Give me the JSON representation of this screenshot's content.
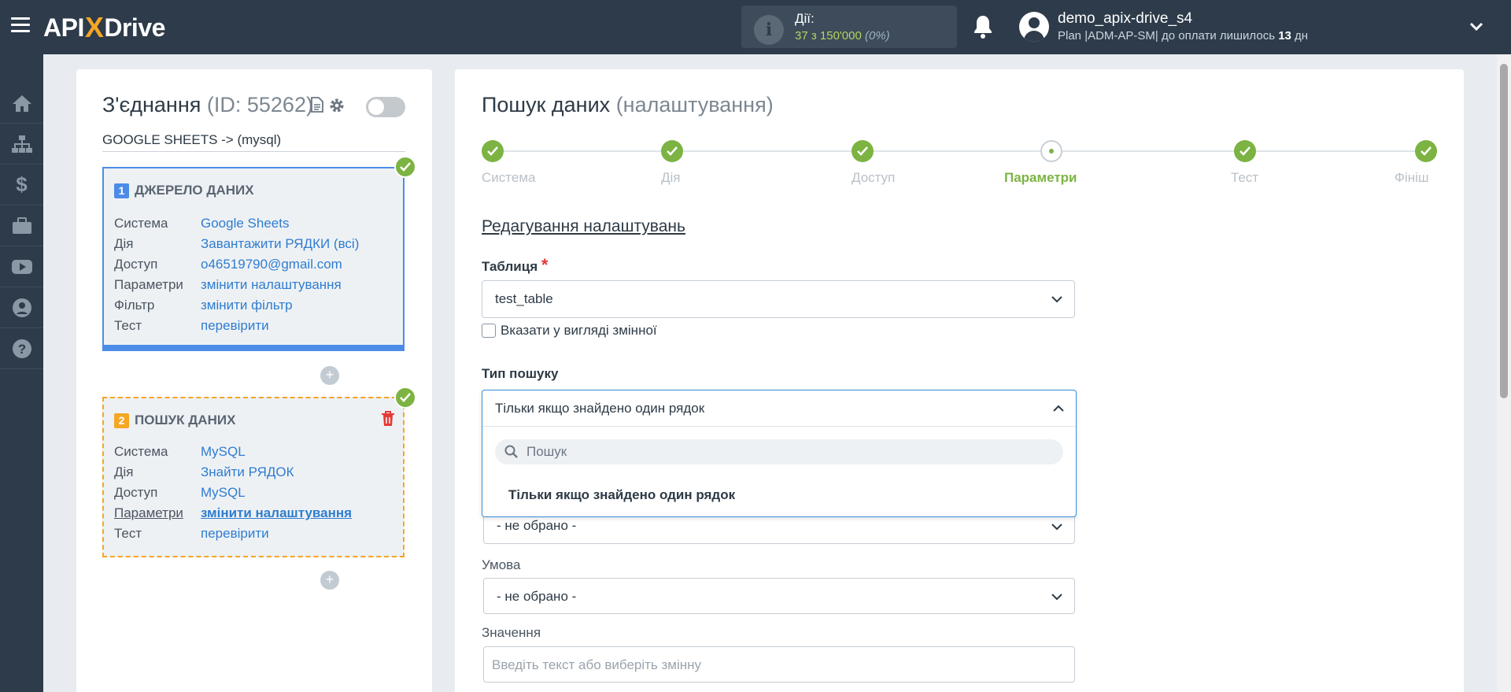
{
  "brand": {
    "pre": "API",
    "x": "X",
    "post": "Drive"
  },
  "actions": {
    "label": "Дії:",
    "count": "37 з 150'000",
    "percent": "(0%)"
  },
  "user": {
    "name": "demo_apix-drive_s4",
    "plan_prefix": "Plan |ADM-AP-SM| до оплати лишилось ",
    "days": "13",
    "days_suffix": " дн"
  },
  "sidebar": {
    "items": [
      "home-icon",
      "sitemap-icon",
      "dollar-icon",
      "briefcase-icon",
      "youtube-icon",
      "user-icon",
      "help-icon"
    ]
  },
  "connection": {
    "title": "З'єднання",
    "id_text": "(ID: 55262)",
    "subtitle": "GOOGLE SHEETS -> (mysql)"
  },
  "cards": [
    {
      "num": "1",
      "title": "ДЖЕРЕЛО ДАНИХ",
      "rows": [
        {
          "key": "Система",
          "value": "Google Sheets"
        },
        {
          "key": "Дія",
          "value": "Завантажити РЯДКИ (всі)"
        },
        {
          "key": "Доступ",
          "value": "o46519790@gmail.com"
        },
        {
          "key": "Параметри",
          "value": "змінити налаштування"
        },
        {
          "key": "Фільтр",
          "value": "змінити фільтр"
        },
        {
          "key": "Тест",
          "value": "перевірити"
        }
      ]
    },
    {
      "num": "2",
      "title": "ПОШУК ДАНИХ",
      "rows": [
        {
          "key": "Система",
          "value": "MySQL"
        },
        {
          "key": "Дія",
          "value": "Знайти РЯДОК"
        },
        {
          "key": "Доступ",
          "value": "MySQL"
        },
        {
          "key": "Параметри",
          "value": "змінити налаштування"
        },
        {
          "key": "Тест",
          "value": "перевірити"
        }
      ]
    }
  ],
  "plus": "+",
  "main": {
    "title": "Пошук даних",
    "title_muted": "(налаштування)",
    "steps": [
      {
        "label": "Система"
      },
      {
        "label": "Дія"
      },
      {
        "label": "Доступ"
      },
      {
        "label": "Параметри"
      },
      {
        "label": "Тест"
      },
      {
        "label": "Фініш"
      }
    ],
    "current_step": "Параметри",
    "section_title": "Редагування налаштувань",
    "table": {
      "label": "Таблиця",
      "required_mark": "*",
      "value": "test_table"
    },
    "variable_checkbox": {
      "label": "Вказати у вигляді змінної",
      "checked": false
    },
    "search_type": {
      "label": "Тип пошуку",
      "value": "Тільки якщо знайдено один рядок",
      "search_placeholder": "Пошук",
      "options": [
        "Тільки якщо знайдено один рядок"
      ]
    },
    "field_select": {
      "value": "- не обрано -"
    },
    "condition": {
      "label": "Умова",
      "value": "- не обрано -"
    },
    "value_field": {
      "label": "Значення",
      "placeholder": "Введіть текст або виберіть змінну"
    }
  },
  "colors": {
    "topbar": "#2d3b4a",
    "accent_green": "#7cb342",
    "accent_blue": "#4c8ce8",
    "accent_orange": "#f5a623",
    "link": "#2f7dd0"
  }
}
